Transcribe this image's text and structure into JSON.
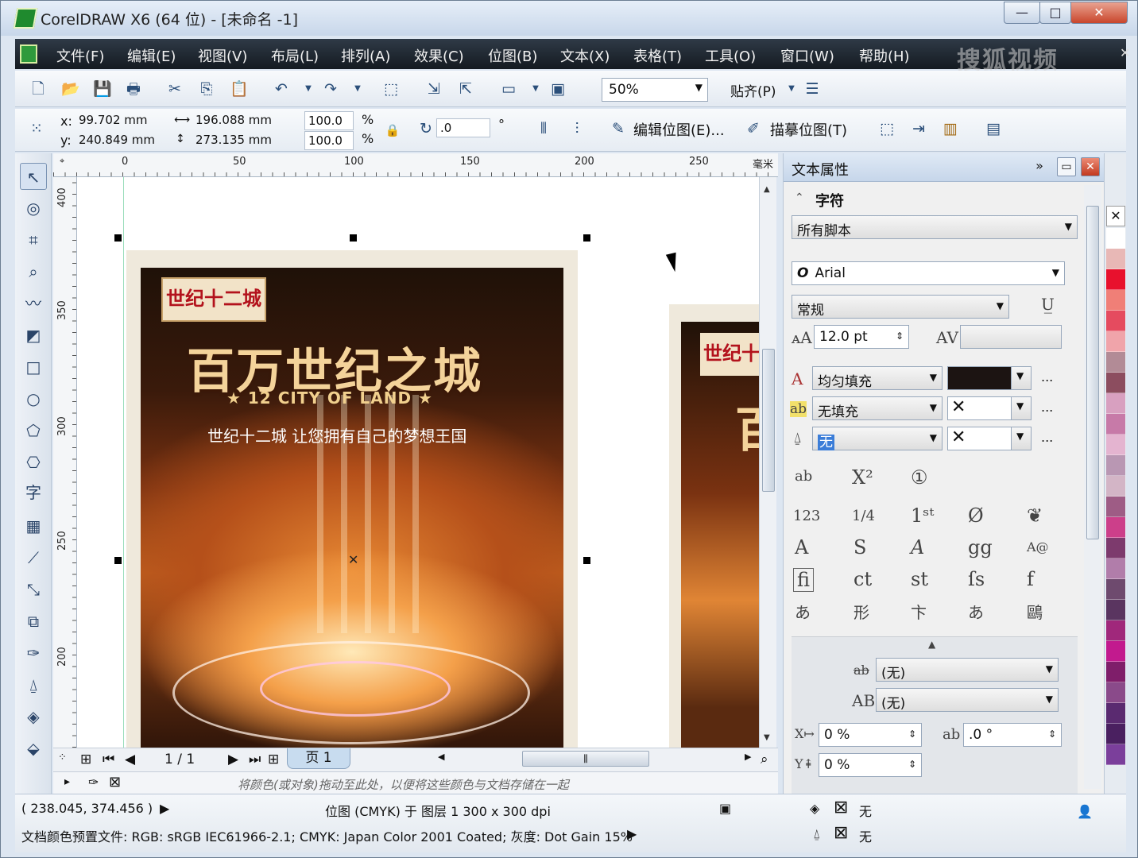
{
  "window": {
    "title": "CorelDRAW X6 (64 位) - [未命名 -1]",
    "controls": [
      "—",
      "□",
      "✕"
    ]
  },
  "menu": {
    "items": [
      "文件(F)",
      "编辑(E)",
      "视图(V)",
      "布局(L)",
      "排列(A)",
      "效果(C)",
      "位图(B)",
      "文本(X)",
      "表格(T)",
      "工具(O)",
      "窗口(W)",
      "帮助(H)"
    ],
    "watermark": "搜狐视频"
  },
  "toolbar": {
    "zoom": "50%",
    "snap": "贴齐(P)"
  },
  "property_bar": {
    "x_label": "x:",
    "x_value": "99.702 mm",
    "y_label": "y:",
    "y_value": "240.849 mm",
    "width": "196.088 mm",
    "height": "273.135 mm",
    "scale_x": "100.0",
    "scale_y": "100.0",
    "percent": "%",
    "rotation": ".0",
    "degree": "°",
    "edit_bitmap": "编辑位图(E)...",
    "trace_bitmap": "描摹位图(T)"
  },
  "ruler": {
    "h_ticks": [
      "0",
      "50",
      "100",
      "150",
      "200",
      "250"
    ],
    "h_unit": "毫米",
    "v_ticks": [
      "400",
      "350",
      "300",
      "250",
      "200"
    ]
  },
  "poster": {
    "logo": "世纪十二城",
    "title": "百万世纪之城",
    "subtitle": "★ 12 CITY OF LAND ★",
    "tagline": "世纪十二城 让您拥有自己的梦想王国",
    "second_logo": "世纪十",
    "second_title": "百"
  },
  "page_nav": {
    "counter": "1 / 1",
    "tab": "页 1",
    "hint": "将颜色(或对象)拖动至此处，以便将这些颜色与文档存储在一起"
  },
  "docker": {
    "title": "文本属性",
    "section": "字符",
    "script": "所有脚本",
    "font": "Arial",
    "style": "常规",
    "size": "12.0 pt",
    "fill_type": "均匀填充",
    "fill_color": "#1c1412",
    "bg_fill": "无填充",
    "outline": "无",
    "strike": "(无)",
    "caps": "(无)",
    "x_offset": "0 %",
    "y_offset": "0 %",
    "angle": ".0 °",
    "more": "..."
  },
  "palette": {
    "colors": [
      "#ffffff",
      "#e8b8b6",
      "#e8112d",
      "#f07f77",
      "#e54b5f",
      "#f0a4aa",
      "#b28b96",
      "#8c4d5f",
      "#d8a0c0",
      "#c77aa8",
      "#e4b4d0",
      "#b997b3",
      "#d3b5c6",
      "#9e5c85",
      "#cc3f8a",
      "#7d3a6d",
      "#b17daa",
      "#6e4a6e",
      "#5a3560",
      "#a0287b",
      "#c21a8e",
      "#7f1e6a",
      "#8a4a8a",
      "#5a2a70",
      "#4a2060",
      "#7b3f9b",
      "#6a3e8e",
      "#5e2d80"
    ]
  },
  "status": {
    "coords": "( 238.045, 374.456 )",
    "object_info": "位图 (CMYK) 于 图层 1 300 x 300 dpi",
    "color_profile": "文档颜色预置文件: RGB: sRGB IEC61966-2.1; CMYK: Japan Color 2001 Coated; 灰度: Dot Gain 15%",
    "fill_label": "无",
    "outline_label": "无"
  }
}
